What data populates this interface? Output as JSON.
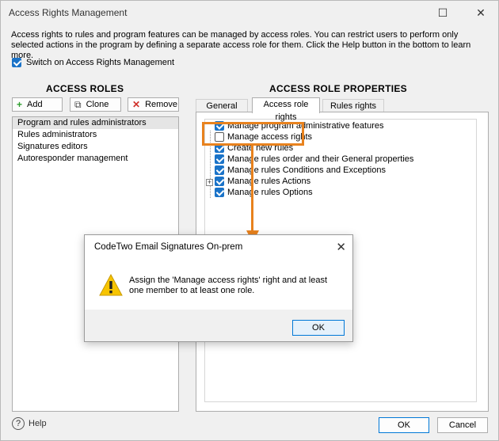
{
  "window": {
    "title": "Access Rights Management",
    "minimize": "–",
    "maximize": "☐",
    "close": "✕"
  },
  "description": "Access rights to rules and program features can be managed by access roles. You can restrict users to perform only selected actions in the program by defining a separate access role for them. Click the Help button in the bottom to learn more.",
  "switch_label": "Switch on Access Rights Management",
  "roles": {
    "title": "ACCESS ROLES",
    "add": "Add",
    "clone": "Clone",
    "remove": "Remove",
    "items": [
      "Program and rules administrators",
      "Rules administrators",
      "Signatures editors",
      "Autoresponder management"
    ]
  },
  "props": {
    "title": "ACCESS ROLE PROPERTIES",
    "tabs": [
      "General",
      "Access role rights",
      "Rules rights"
    ],
    "rights": [
      {
        "label": "Manage program administrative features",
        "checked": true
      },
      {
        "label": "Manage access rights",
        "checked": false
      },
      {
        "label": "Create new rules",
        "checked": true
      },
      {
        "label": "Manage rules order and their General properties",
        "checked": true
      },
      {
        "label": "Manage rules Conditions and Exceptions",
        "checked": true
      },
      {
        "label": "Manage rules Actions",
        "checked": true
      },
      {
        "label": "Manage rules Options",
        "checked": true
      }
    ]
  },
  "dialog": {
    "title": "CodeTwo Email Signatures On-prem",
    "close": "✕",
    "message": "Assign the 'Manage access rights' right and at least one member to at least one role.",
    "ok": "OK"
  },
  "footer": {
    "help_icon": "?",
    "help": "Help",
    "ok": "OK",
    "cancel": "Cancel"
  },
  "colors": {
    "accent": "#1a73c8",
    "highlight": "#e8821e"
  }
}
